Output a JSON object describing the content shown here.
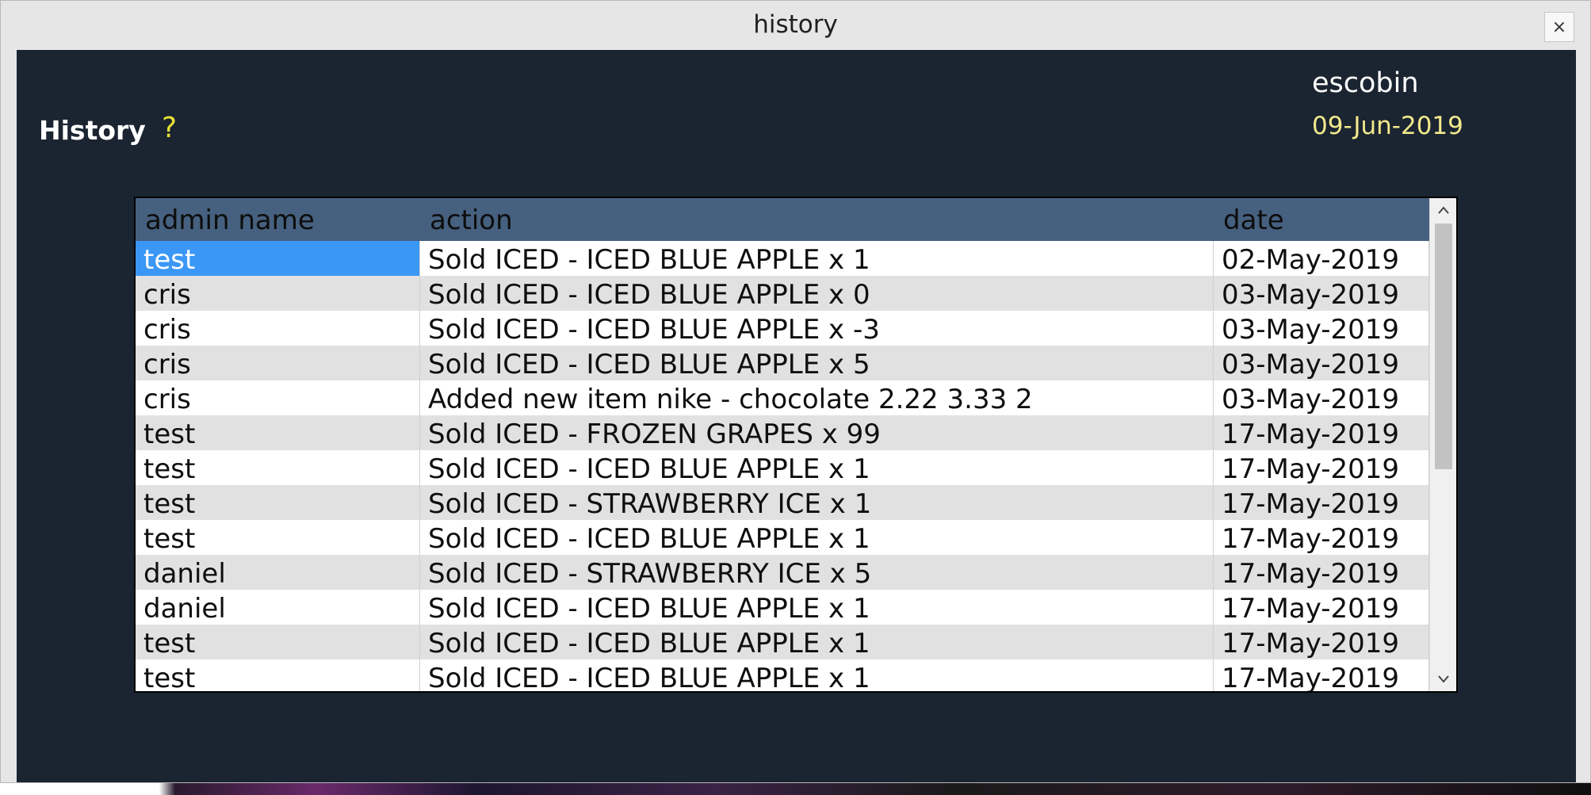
{
  "window": {
    "title": "history",
    "close_label": "×"
  },
  "header": {
    "page_title": "History",
    "help_label": "?",
    "username": "escobin",
    "date": "09-Jun-2019"
  },
  "table": {
    "columns": [
      "admin name",
      "action",
      "date"
    ],
    "rows": [
      {
        "admin": "test",
        "action": "Sold ICED - ICED BLUE APPLE x 1",
        "date": "02-May-2019"
      },
      {
        "admin": "cris",
        "action": "Sold ICED - ICED BLUE APPLE x 0",
        "date": "03-May-2019"
      },
      {
        "admin": "cris",
        "action": "Sold ICED - ICED BLUE APPLE x -3",
        "date": "03-May-2019"
      },
      {
        "admin": "cris",
        "action": "Sold ICED - ICED BLUE APPLE x 5",
        "date": "03-May-2019"
      },
      {
        "admin": "cris",
        "action": "Added new item nike - chocolate 2.22 3.33 2",
        "date": "03-May-2019"
      },
      {
        "admin": "test",
        "action": "Sold ICED - FROZEN GRAPES x 99",
        "date": "17-May-2019"
      },
      {
        "admin": "test",
        "action": "Sold ICED - ICED BLUE APPLE x 1",
        "date": "17-May-2019"
      },
      {
        "admin": "test",
        "action": "Sold ICED - STRAWBERRY ICE x 1",
        "date": "17-May-2019"
      },
      {
        "admin": "test",
        "action": "Sold ICED - ICED BLUE APPLE x 1",
        "date": "17-May-2019"
      },
      {
        "admin": "daniel",
        "action": "Sold ICED - STRAWBERRY ICE x 5",
        "date": "17-May-2019"
      },
      {
        "admin": "daniel",
        "action": "Sold ICED - ICED BLUE APPLE x 1",
        "date": "17-May-2019"
      },
      {
        "admin": "test",
        "action": "Sold ICED - ICED BLUE APPLE x 1",
        "date": "17-May-2019"
      },
      {
        "admin": "test",
        "action": "Sold ICED - ICED BLUE APPLE x 1",
        "date": "17-May-2019"
      }
    ]
  },
  "scrollbar": {
    "up_icon": "chevron-up-icon",
    "down_icon": "chevron-down-icon"
  },
  "colors": {
    "background": "#1b2431",
    "header_row": "#46607f",
    "selection": "#3b97f6",
    "help_icon": "#e8e035",
    "date_text": "#f1e98c"
  }
}
